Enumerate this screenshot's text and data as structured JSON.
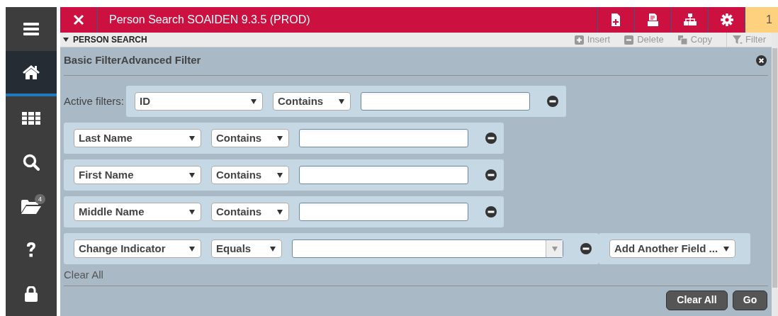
{
  "sidebar": {
    "items": [
      {
        "kind": "menu",
        "selected": false
      },
      {
        "kind": "home",
        "selected": true
      },
      {
        "kind": "apps",
        "selected": false
      },
      {
        "kind": "search",
        "selected": false
      },
      {
        "kind": "folder",
        "selected": false,
        "badge": "4"
      },
      {
        "kind": "help",
        "selected": false
      },
      {
        "kind": "lock",
        "selected": false
      }
    ]
  },
  "header": {
    "title": "Person Search SOAIDEN 9.3.5 (PROD)",
    "tools": [
      {
        "kind": "add-page"
      },
      {
        "kind": "document"
      },
      {
        "kind": "hierarchy"
      },
      {
        "kind": "settings"
      }
    ],
    "notification_count": "1"
  },
  "section": {
    "title": "PERSON SEARCH",
    "expanded": true,
    "actions": [
      {
        "kind": "insert",
        "label": "Insert",
        "disabled": true
      },
      {
        "kind": "delete",
        "label": "Delete",
        "disabled": true
      },
      {
        "kind": "copy",
        "label": "Copy",
        "disabled": true
      },
      {
        "kind": "filter",
        "label": "Filter",
        "disabled": true
      }
    ]
  },
  "filter_panel": {
    "tabs_heading": "Basic FilterAdvanced Filter",
    "active_filters_label": "Active filters:",
    "filters": [
      {
        "field": "ID",
        "operator": "Contains",
        "kind": "text"
      },
      {
        "field": "Last Name",
        "operator": "Contains",
        "kind": "text"
      },
      {
        "field": "First Name",
        "operator": "Contains",
        "kind": "text"
      },
      {
        "field": "Middle Name",
        "operator": "Contains",
        "kind": "text"
      },
      {
        "field": "Change Indicator",
        "operator": "Equals",
        "kind": "combo"
      }
    ],
    "add_field": "Add Another Field ...",
    "clear_all_link": "Clear All",
    "buttons": [
      "Clear All",
      "Go"
    ]
  }
}
